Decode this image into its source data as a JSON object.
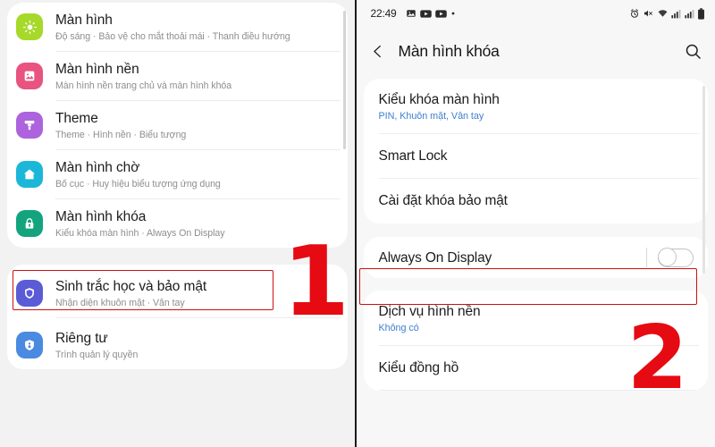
{
  "left_panel": {
    "groups": [
      {
        "items": [
          {
            "title": "Màn hình",
            "subtitle": "Độ sáng  ·  Bảo vệ cho mắt thoải mái  ·  Thanh điều hướng",
            "icon": "brightness-icon",
            "color": "#a6d929"
          },
          {
            "title": "Màn hình nền",
            "subtitle": "Màn hình nền trang chủ và màn hình khóa",
            "icon": "wallpaper-icon",
            "color": "#e8537f"
          },
          {
            "title": "Theme",
            "subtitle": "Theme  ·  Hình nền  ·  Biểu tượng",
            "icon": "theme-brush-icon",
            "color": "#ac63dd"
          },
          {
            "title": "Màn hình chờ",
            "subtitle": "Bố cục  ·  Huy hiệu biểu tượng ứng dụng",
            "icon": "home-screen-icon",
            "color": "#1cb7d8"
          },
          {
            "title": "Màn hình khóa",
            "subtitle": "Kiểu khóa màn hình  ·  Always On Display",
            "icon": "lock-icon",
            "color": "#13a47e"
          }
        ]
      },
      {
        "items": [
          {
            "title": "Sinh trắc học và bảo mật",
            "subtitle": "Nhận diện khuôn mặt  ·  Vân tay",
            "icon": "security-shield-icon",
            "color": "#5b5bd6"
          },
          {
            "title": "Riêng tư",
            "subtitle": "Trình quản lý quyền",
            "icon": "privacy-person-icon",
            "color": "#4a8ae0"
          }
        ]
      }
    ]
  },
  "right_panel": {
    "status_bar": {
      "time": "22:49",
      "left_icons": [
        "gallery-icon",
        "youtube-icon",
        "youtube-music-icon",
        "more-dot-icon"
      ],
      "right_icons": [
        "alarm-icon",
        "mute-icon",
        "wifi-icon",
        "signal-1-icon",
        "signal-2-icon",
        "battery-icon"
      ]
    },
    "app_bar": {
      "back_icon": "back-chevron-icon",
      "title": "Màn hình khóa",
      "search_icon": "search-icon"
    },
    "groups": [
      {
        "items": [
          {
            "title": "Kiểu khóa màn hình",
            "subtitle": "PIN, Khuôn mặt, Vân tay",
            "toggle": null
          },
          {
            "title": "Smart Lock",
            "subtitle": "",
            "toggle": null
          },
          {
            "title": "Cài đặt khóa bảo mật",
            "subtitle": "",
            "toggle": null
          }
        ]
      },
      {
        "items": [
          {
            "title": "Always On Display",
            "subtitle": "",
            "toggle": "off"
          }
        ]
      },
      {
        "items": [
          {
            "title": "Dịch vụ hình nền",
            "subtitle": "Không có",
            "toggle": null
          },
          {
            "title": "Kiểu đồng hồ",
            "subtitle": "",
            "toggle": null
          }
        ]
      }
    ]
  },
  "annotations": {
    "step_one": "1",
    "step_two": "2",
    "highlight_color": "#cc1111",
    "number_color": "#e60a12"
  }
}
